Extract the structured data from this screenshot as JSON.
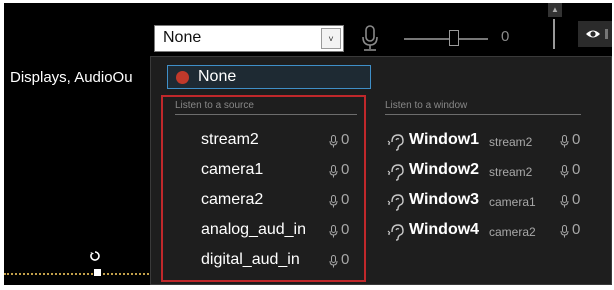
{
  "background": {
    "label": "Displays, AudioOu",
    "partial_text": "..."
  },
  "combo": {
    "value": "None",
    "dropdown_glyph": "˅"
  },
  "volume": {
    "value": "0",
    "mic_icon": "microphone-icon"
  },
  "dropdown": {
    "none_label": "None",
    "source_header": "Listen to a source",
    "window_header": "Listen to a window",
    "sources": [
      {
        "name": "stream2",
        "level": "0"
      },
      {
        "name": "camera1",
        "level": "0"
      },
      {
        "name": "camera2",
        "level": "0"
      },
      {
        "name": "analog_aud_in",
        "level": "0"
      },
      {
        "name": "digital_aud_in",
        "level": "0"
      }
    ],
    "windows": [
      {
        "name": "Window1",
        "source": "stream2",
        "level": "0"
      },
      {
        "name": "Window2",
        "source": "stream2",
        "level": "0"
      },
      {
        "name": "Window3",
        "source": "camera1",
        "level": "0"
      },
      {
        "name": "Window4",
        "source": "camera2",
        "level": "0"
      }
    ]
  },
  "colors": {
    "highlight_border": "#c0282b",
    "selection_border": "#3f8fc8",
    "dropdown_bg": "#1e1e1e",
    "panel_bg": "#000000"
  }
}
